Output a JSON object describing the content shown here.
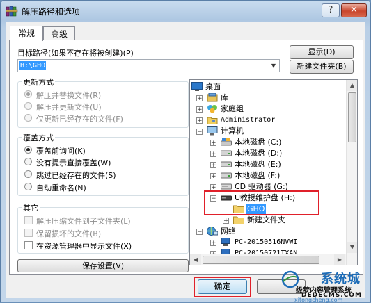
{
  "window": {
    "title": "解压路径和选项",
    "help_button": "?",
    "close_button": "✕"
  },
  "tabs": [
    {
      "label": "常规",
      "active": true
    },
    {
      "label": "高级",
      "active": false
    }
  ],
  "dest": {
    "label": "目标路径(如果不存在将被创建)(P)",
    "value": "H:\\GHO",
    "show_button": "显示(D)",
    "new_folder_button": "新建文件夹(B)"
  },
  "update_mode": {
    "title": "更新方式",
    "options": [
      {
        "label": "解压并替换文件(R)",
        "selected": true
      },
      {
        "label": "解压并更新文件(U)",
        "selected": false
      },
      {
        "label": "仅更新已经存在的文件(F)",
        "selected": false
      }
    ]
  },
  "overwrite_mode": {
    "title": "覆盖方式",
    "options": [
      {
        "label": "覆盖前询问(K)",
        "selected": true
      },
      {
        "label": "没有提示直接覆盖(W)",
        "selected": false
      },
      {
        "label": "跳过已经存在的文件(S)",
        "selected": false
      },
      {
        "label": "自动重命名(N)",
        "selected": false
      }
    ]
  },
  "misc": {
    "title": "其它",
    "options": [
      {
        "label": "解压压缩文件到子文件夹(L)",
        "checked": false,
        "disabled": true
      },
      {
        "label": "保留损坏的文件(B)",
        "checked": false,
        "disabled": true
      },
      {
        "label": "在资源管理器中显示文件(X)",
        "checked": false,
        "disabled": false
      }
    ]
  },
  "save_button": "保存设置(V)",
  "tree": [
    {
      "label": "桌面",
      "icon": "desktop-icon"
    },
    {
      "label": "库",
      "icon": "library-icon"
    },
    {
      "label": "家庭组",
      "icon": "homegroup-icon"
    },
    {
      "label": "Administrator",
      "icon": "user-folder-icon"
    },
    {
      "label": "计算机",
      "icon": "computer-icon"
    },
    {
      "label": "本地磁盘 (C:)",
      "icon": "system-drive-icon"
    },
    {
      "label": "本地磁盘 (D:)",
      "icon": "drive-icon"
    },
    {
      "label": "本地磁盘 (E:)",
      "icon": "drive-icon"
    },
    {
      "label": "本地磁盘 (F:)",
      "icon": "drive-icon"
    },
    {
      "label": "CD 驱动器 (G:)",
      "icon": "cd-drive-icon"
    },
    {
      "label": "U教授维护盘 (H:)",
      "icon": "usb-drive-icon"
    },
    {
      "label": "GHO",
      "icon": "folder-icon"
    },
    {
      "label": "新建文件夹",
      "icon": "folder-icon"
    },
    {
      "label": "网络",
      "icon": "network-icon"
    },
    {
      "label": "PC-20150516NVWI",
      "icon": "network-computer-icon"
    },
    {
      "label": "PC-20150721TXAN",
      "icon": "network-computer-icon"
    }
  ],
  "ok_button": "确定",
  "watermark": {
    "brand": "系统城",
    "line1": "级梦内容管理系统",
    "line2": "DEDECMS.COM",
    "url": "xitongcheng.com"
  },
  "colors": {
    "highlight_red": "#e0202a",
    "selection_blue": "#3399ff"
  }
}
